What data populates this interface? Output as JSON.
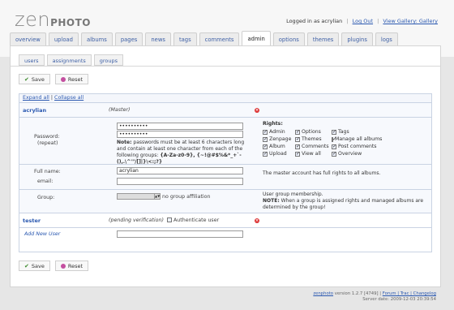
{
  "header": {
    "logo_zen": "zen",
    "logo_photo": "PHOTO",
    "logged_in": "Logged in as acrylian",
    "logout": "Log Out",
    "view_gallery": "View Gallery: Gallery"
  },
  "tabs": [
    "overview",
    "upload",
    "albums",
    "pages",
    "news",
    "tags",
    "comments",
    "admin",
    "options",
    "themes",
    "plugins",
    "logs"
  ],
  "subtabs": [
    "users",
    "assignments",
    "groups"
  ],
  "buttons": {
    "save": "Save",
    "reset": "Reset"
  },
  "table": {
    "expand_all": "Expand all",
    "collapse_all": "Collapse all",
    "user1": {
      "name": "acrylian",
      "status": "(Master)",
      "password_label": "Password:",
      "repeat_label": "(repeat)",
      "password_value": "••••••••••",
      "repeat_value": "••••••••••",
      "password_note_bold": "Note:",
      "password_note": "passwords must be at least 6 characters long and contain at least one character from each of the following groups:",
      "password_groups": "{A-Za-z0-9}, {~!@#$%&*_+`-(),.\\^'\"/[]|}\\<:;?}",
      "fullname_label": "Full name:",
      "fullname_value": "acrylian",
      "email_label": "email:",
      "email_value": "",
      "group_label": "Group:",
      "group_text": "no group affiliation",
      "rights_title": "Rights:",
      "rights": [
        {
          "label": "Admin",
          "checked": true
        },
        {
          "label": "Options",
          "checked": true
        },
        {
          "label": "Tags",
          "checked": true
        },
        {
          "label": "Zenpage",
          "checked": true
        },
        {
          "label": "Themes",
          "checked": true
        },
        {
          "label": "Manage all albums",
          "checked": true
        },
        {
          "label": "Album",
          "checked": true
        },
        {
          "label": "Comments",
          "checked": true
        },
        {
          "label": "Post comments",
          "checked": true
        },
        {
          "label": "Upload",
          "checked": true
        },
        {
          "label": "View all",
          "checked": true
        },
        {
          "label": "Overview",
          "checked": true
        }
      ],
      "master_note": "The master account has full rights to all albums.",
      "membership_title": "User group membership.",
      "membership_note_bold": "NOTE:",
      "membership_note": "When a group is assigned rights and managed albums are determined by the group!"
    },
    "user2": {
      "name": "tester",
      "status": "(pending verification)",
      "authenticate": "Authenticate user"
    },
    "add_new": "Add New User"
  },
  "footer": {
    "line1_brand": "zenphoto",
    "line1_version": "version 1.2.7 [4749]",
    "line1_links": "Forum | Trac | Changelog",
    "line2": "Server date: 2009-12-03 20:39:54"
  }
}
